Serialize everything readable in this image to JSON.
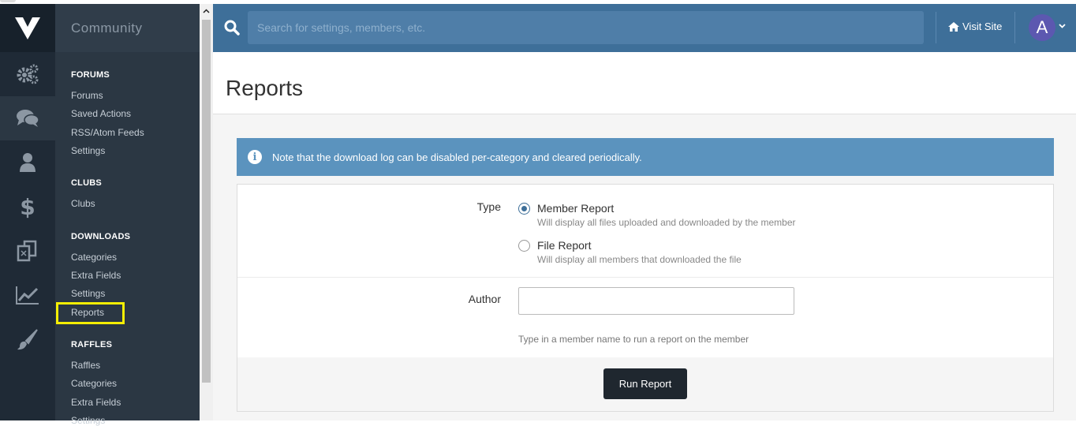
{
  "sidebar": {
    "section_title": "Community",
    "rail_icons": [
      "gears-icon",
      "chat-icon",
      "user-icon",
      "dollar-icon",
      "clipboard-icon",
      "chart-icon",
      "brush-icon"
    ],
    "groups": [
      {
        "title": "FORUMS",
        "items": [
          "Forums",
          "Saved Actions",
          "RSS/Atom Feeds",
          "Settings"
        ]
      },
      {
        "title": "CLUBS",
        "items": [
          "Clubs"
        ]
      },
      {
        "title": "DOWNLOADS",
        "items": [
          "Categories",
          "Extra Fields",
          "Settings",
          "Reports"
        ]
      },
      {
        "title": "RAFFLES",
        "items": [
          "Raffles",
          "Categories",
          "Extra Fields",
          "Settings"
        ]
      }
    ],
    "active_item": "Reports"
  },
  "header": {
    "search_placeholder": "Search for settings, members, etc.",
    "visit_site": "Visit Site",
    "avatar_letter": "A"
  },
  "page": {
    "title": "Reports",
    "notice": "Note that the download log can be disabled per-category and cleared periodically.",
    "form": {
      "type_label": "Type",
      "options": [
        {
          "label": "Member Report",
          "desc": "Will display all files uploaded and downloaded by the member",
          "checked": true
        },
        {
          "label": "File Report",
          "desc": "Will display all members that downloaded the file",
          "checked": false
        }
      ],
      "author_label": "Author",
      "author_value": "",
      "author_hint": "Type in a member name to run a report on the member",
      "submit_label": "Run Report"
    }
  },
  "colors": {
    "accent": "#3e6f99",
    "highlight": "#f5ee05"
  }
}
